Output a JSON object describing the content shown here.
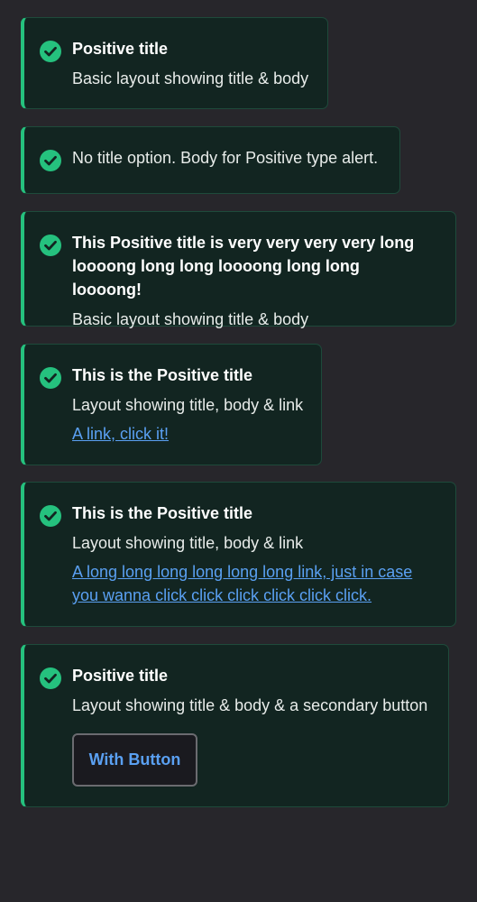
{
  "colors": {
    "page_bg": "#27262b",
    "alert_bg": "#122521",
    "accent_positive": "#25c17e",
    "link": "#5aa0f2"
  },
  "alerts": [
    {
      "icon": "check-circle-icon",
      "title": "Positive title",
      "body": "Basic layout showing title & body"
    },
    {
      "icon": "check-circle-icon",
      "body": "No title option. Body for Positive type alert."
    },
    {
      "icon": "check-circle-icon",
      "title": "This Positive title is very very very very  long loooong long long loooong long long loooong!",
      "body": "Basic layout showing title & body"
    },
    {
      "icon": "check-circle-icon",
      "title": "This is the Positive title",
      "body": "Layout showing title, body & link",
      "link": "A link, click it!"
    },
    {
      "icon": "check-circle-icon",
      "title": "This is the Positive title",
      "body": "Layout showing title, body & link",
      "link": "A long long long long long long link, just in case you wanna click click click click click click."
    },
    {
      "icon": "check-circle-icon",
      "title": "Positive title",
      "body": "Layout showing title & body & a secondary button",
      "button": "With Button"
    }
  ]
}
